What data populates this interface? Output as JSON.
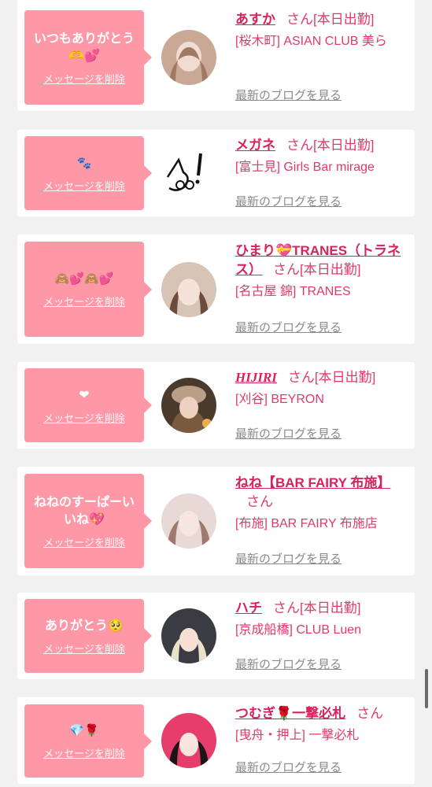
{
  "delete_label": "メッセージを削除",
  "blog_label": "最新のブログを見る",
  "san": "さん",
  "accent_color": "#fe98a7",
  "name_color": "#d6235c",
  "cards": [
    {
      "message": "いつもありがとう\n🫶💕",
      "name": "あすか",
      "status": "[本日出勤]",
      "shop": "[桜木町] ASIAN CLUB 美ら",
      "avatar": "girl-photo"
    },
    {
      "message": "🐾",
      "name": "メガネ",
      "status": "[本日出勤]",
      "shop": "[富士見] Girls Bar mirage",
      "avatar": "cat-drawing"
    },
    {
      "message": "🙈💕🙈💕",
      "name": "ひまり💝TRANES（トラネス）",
      "status": "[本日出勤]",
      "shop": "[名古屋 錦] TRANES",
      "avatar": "girl-photo"
    },
    {
      "message": "❤",
      "name": "HIJIRI",
      "status": "[本日出勤]",
      "shop": "[刈谷] BEYRON",
      "avatar": "girl-photo"
    },
    {
      "message": "ねねのすーぱーいいね💖",
      "name": "ねね【BAR FAIRY 布施】",
      "status": "",
      "shop": "[布施] BAR FAIRY 布施店",
      "avatar": "girl-photo"
    },
    {
      "message": "ありがとう🥺",
      "name": "ハチ",
      "status": "[本日出勤]",
      "shop": "[京成船橋] CLUB Luen",
      "avatar": "girl-photo"
    },
    {
      "message": "💎🌹",
      "name": "つむぎ🌹一撃必札",
      "status": "",
      "shop": "[曳舟・押上] 一撃必札",
      "avatar": "girl-photo"
    }
  ]
}
